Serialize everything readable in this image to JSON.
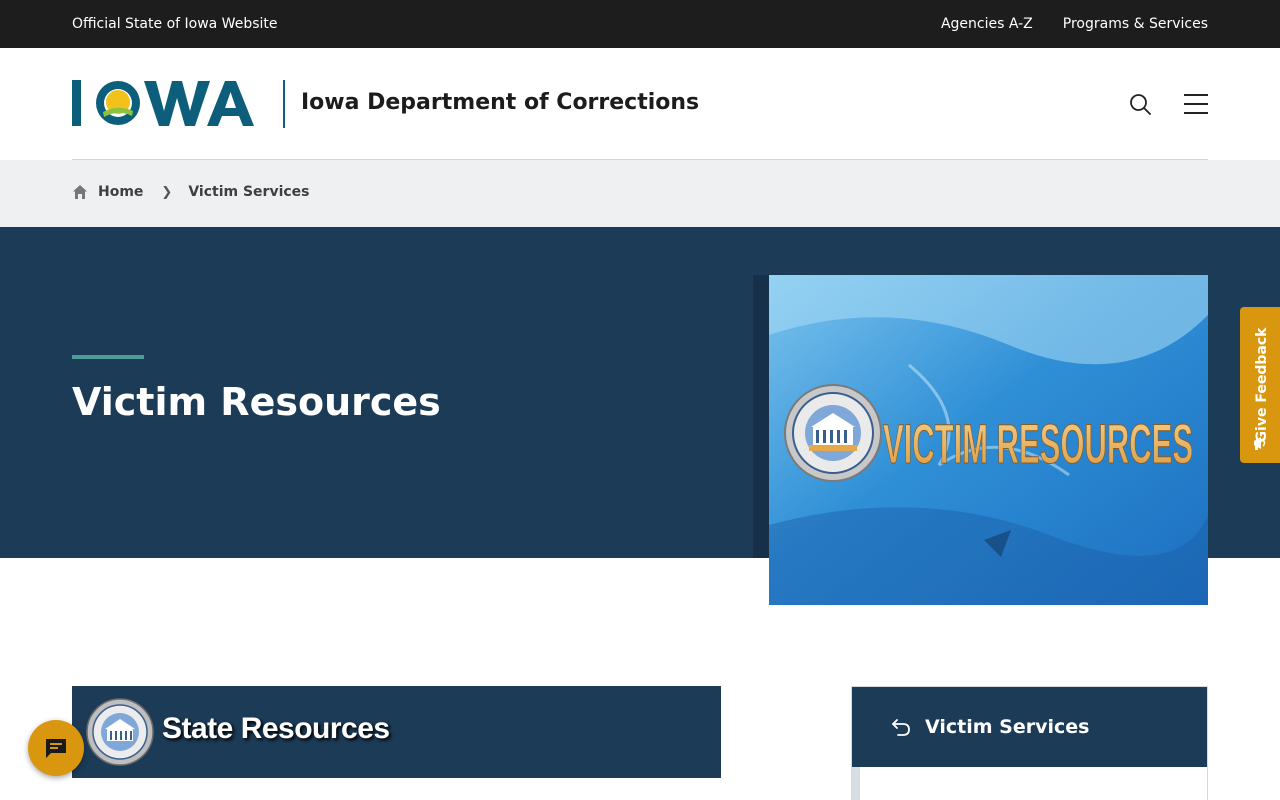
{
  "topbar": {
    "official_label": "Official State of Iowa Website",
    "links": [
      "Agencies A-Z",
      "Programs & Services"
    ]
  },
  "header": {
    "logo_text": "IOWA",
    "agency_name": "Iowa Department of Corrections",
    "icons": [
      "search-icon",
      "menu-icon"
    ]
  },
  "breadcrumb": {
    "home_label": "Home",
    "current_label": "Victim Services"
  },
  "hero": {
    "title": "Victim Resources",
    "image": {
      "headline": "VICTIM RESOURCES",
      "seal_top": "STATE OF IOWA",
      "seal_bottom": "DEPARTMENT OF CORRECTIONS"
    }
  },
  "content": {
    "banner_text": "State Resources"
  },
  "side_nav": {
    "title": "Victim Services"
  },
  "feedback": {
    "label": "Give Feedback"
  },
  "chat": {
    "icon": "chat-icon"
  },
  "colors": {
    "topbar": "#1d1d1d",
    "navy": "#1c3b57",
    "teal_accent": "#4f9b97",
    "gold": "#d9960f",
    "logo_blue": "#0d5e7b"
  }
}
